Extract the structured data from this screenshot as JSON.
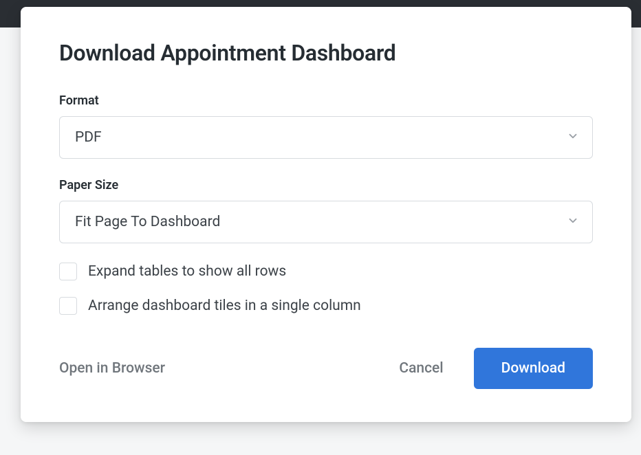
{
  "modal": {
    "title": "Download Appointment Dashboard",
    "format": {
      "label": "Format",
      "value": "PDF"
    },
    "paperSize": {
      "label": "Paper Size",
      "value": "Fit Page To Dashboard"
    },
    "options": {
      "expandTables": {
        "label": "Expand tables to show all rows",
        "checked": false
      },
      "singleColumn": {
        "label": "Arrange dashboard tiles in a single column",
        "checked": false
      }
    },
    "actions": {
      "openInBrowser": "Open in Browser",
      "cancel": "Cancel",
      "download": "Download"
    }
  }
}
